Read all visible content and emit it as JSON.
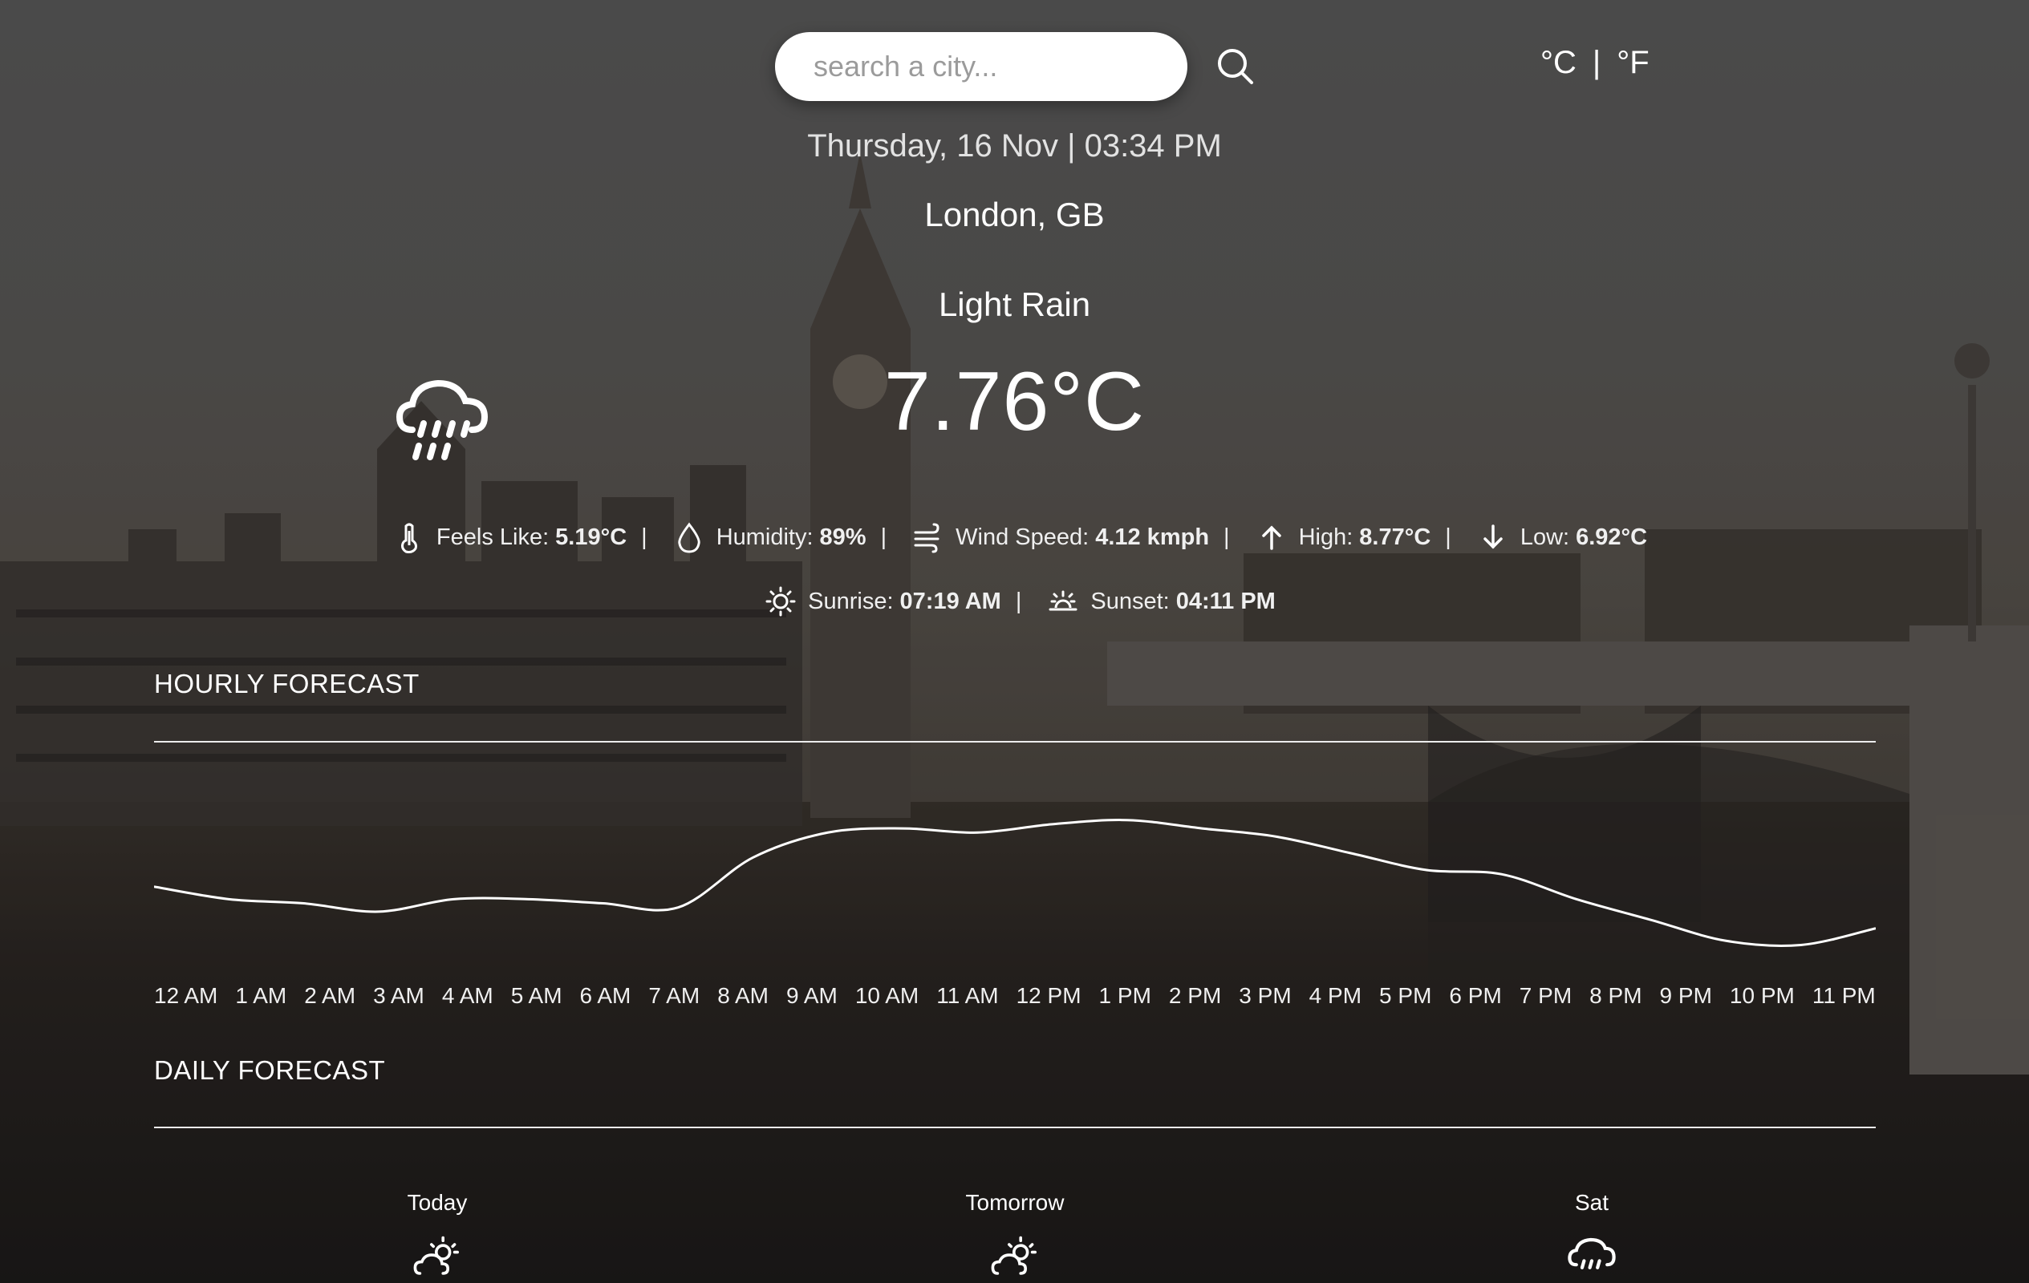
{
  "search": {
    "placeholder": "search a city..."
  },
  "units": {
    "celsius": "°C",
    "divider": "|",
    "fahrenheit": "°F"
  },
  "datetime": "Thursday, 16 Nov | 03:34 PM",
  "location": "London, GB",
  "condition": "Light Rain",
  "temperature": "7.76°C",
  "details": {
    "feels_like_label": "Feels Like:",
    "feels_like": "5.19°C",
    "humidity_label": "Humidity:",
    "humidity": "89%",
    "wind_label": "Wind Speed:",
    "wind": "4.12 kmph",
    "high_label": "High:",
    "high": "8.77°C",
    "low_label": "Low:",
    "low": "6.92°C",
    "sunrise_label": "Sunrise:",
    "sunrise": "07:19 AM",
    "sunset_label": "Sunset:",
    "sunset": "04:11 PM",
    "sep": "|"
  },
  "hourly": {
    "title": "HOURLY FORECAST",
    "hours": [
      "12 AM",
      "1 AM",
      "2 AM",
      "3 AM",
      "4 AM",
      "5 AM",
      "6 AM",
      "7 AM",
      "8 AM",
      "9 AM",
      "10 AM",
      "11 AM",
      "12 PM",
      "1 PM",
      "2 PM",
      "3 PM",
      "4 PM",
      "5 PM",
      "6 PM",
      "7 PM",
      "8 PM",
      "9 PM",
      "10 PM",
      "11 PM"
    ]
  },
  "chart_data": {
    "type": "line",
    "x": [
      "12 AM",
      "1 AM",
      "2 AM",
      "3 AM",
      "4 AM",
      "5 AM",
      "6 AM",
      "7 AM",
      "8 AM",
      "9 AM",
      "10 AM",
      "11 AM",
      "12 PM",
      "1 PM",
      "2 PM",
      "3 PM",
      "4 PM",
      "5 PM",
      "6 PM",
      "7 PM",
      "8 PM",
      "9 PM",
      "10 PM",
      "11 PM"
    ],
    "series": [
      {
        "values": [
          7.1,
          6.95,
          6.9,
          6.8,
          6.95,
          6.95,
          6.9,
          6.85,
          7.45,
          7.75,
          7.8,
          7.75,
          7.85,
          7.9,
          7.8,
          7.7,
          7.5,
          7.3,
          7.25,
          6.95,
          6.7,
          6.45,
          6.4,
          6.6
        ]
      }
    ],
    "ylim": [
      6.0,
      8.6
    ],
    "grid": false
  },
  "daily": {
    "title": "DAILY FORECAST",
    "days": [
      {
        "label": "Today",
        "icon": "partly-cloudy-day-icon"
      },
      {
        "label": "Tomorrow",
        "icon": "partly-cloudy-day-icon"
      },
      {
        "label": "Sat",
        "icon": "rain-cloud-icon"
      }
    ]
  },
  "colors": {
    "text": "#ffffff",
    "line": "#ffffff",
    "search_bg": "#ffffff",
    "placeholder": "#9b9b9b"
  }
}
